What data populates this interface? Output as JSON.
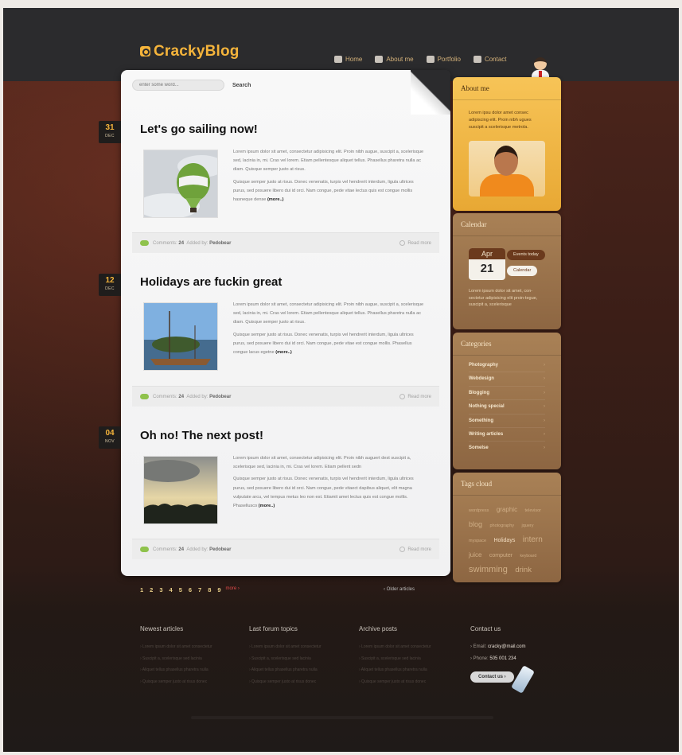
{
  "header": {
    "logo": "CrackyBlog",
    "nav": [
      "Home",
      "About me",
      "Portfolio",
      "Contact"
    ]
  },
  "search": {
    "placeholder": "enter some word...",
    "button": "Search"
  },
  "posts": [
    {
      "day": "31",
      "month": "DEC",
      "title": "Let's go sailing now!",
      "p1": "Lorem ipsum dolor sit amet, consectetur adipisicing elit. Proin nibh augue, suscipit a, scelerisque sed, lacinia in, mi. Cras vel lorem. Etiam pellentesque aliquet tellus. Phasellus pharetra nulla ac diam. Quisque semper justo at risus.",
      "p2": "Quisque semper justo at risus. Donec venenatis, turpis vel hendrerit interdum, ligula ultrices purus, sed posuere libero dui id orci. Nam congue, pede vitae lectus quis est congue mollis hasneque dense",
      "more": "(more..)",
      "comments_label": "Comments:",
      "comments": "24",
      "added_label": "Added by:",
      "author": "Pedobear",
      "read_more": "Read more"
    },
    {
      "day": "12",
      "month": "DEC",
      "title": "Holidays are fuckin great",
      "p1": "Lorem ipsum dolor sit amet, consectetur adipisicing elit. Proin nibh augue, suscipit a, scelerisque sed, lacinia in, mi. Cras vel lorem. Etiam pellentesque aliquet tellus. Phasellus pharetra nulla ac diam. Quisque semper justo at risus.",
      "p2": "Quisque semper justo at risus. Donec venenatis, turpis vel hendrerit interdum, ligula ultrices purus, sed posuere libero dui id orci. Nam congue, pede vitae est congue mollis. Phasellus congue lacus egetne",
      "more": "(more..)",
      "comments_label": "Comments:",
      "comments": "24",
      "added_label": "Added by:",
      "author": "Pedobear",
      "read_more": "Read more"
    },
    {
      "day": "04",
      "month": "NOV",
      "title": "Oh no! The next post!",
      "p1": "Lorem ipsum dolor sit amet, consectetur adipisicing elit. Proin nibh auguert dest suscipit a, scelerisque sed, lacinia in, mi. Cras vel lorem. Etiam pellent sedn",
      "p2": "Quisque semper justo at risus. Donec venenatis, turpis vel hendrerit interdum, ligula ultrices purus, sed posuere libero dui id orci. Nam congue, pede vitaect dapibus aliquet, elit magna vulputate arcu, vel tempus metus leo non est. Etiamit amet lectus quis est congue mollis. Phasellusco",
      "more": "(more..)",
      "comments_label": "Comments:",
      "comments": "24",
      "added_label": "Added by:",
      "author": "Pedobear",
      "read_more": "Read more"
    }
  ],
  "pagination": {
    "pages": [
      "1",
      "2",
      "3",
      "4",
      "5",
      "6",
      "7",
      "8",
      "9"
    ],
    "more": "more ›",
    "older": "‹ Older articles"
  },
  "sidebar": {
    "about": {
      "title": "About me",
      "text": "Lorem ipsu dolor amet consec adipiscing elit. Proin nibh ugues suscipit a scelerisque metrola."
    },
    "calendar": {
      "title": "Calendar",
      "month": "Apr",
      "day": "21",
      "events_btn": "Events today",
      "calendar_btn": "Calendar",
      "text": "Lorem ipsum dolor sit amet, con-sectetur adipisicing elit proin-tegue, suscipit a, scelerisque"
    },
    "categories": {
      "title": "Categories",
      "items": [
        "Photography",
        "Webdesign",
        "Blogging",
        "Nothing special",
        "Something",
        "Writing articles",
        "Somelse"
      ]
    },
    "tags": {
      "title": "Tags cloud",
      "items": [
        "wordpress",
        "graphic",
        "televisor",
        "blog",
        "photography",
        "jquery",
        "myspace",
        "Holidays",
        "intern",
        "juice",
        "computer",
        "keyboard",
        "swimming",
        "drink"
      ]
    }
  },
  "footer": {
    "newest": {
      "title": "Newest articles",
      "links": [
        "› Lorem ipsum dolor sit amet consectetur",
        "› Suscipit a, scelerisque sed lacinia",
        "› Aliquet tellus phasellus pharetra nulla",
        "› Quisque semper justo at risus donec"
      ]
    },
    "forum": {
      "title": "Last forum topics",
      "links": [
        "› Lorem ipsum dolor sit amet consectetur",
        "› Suscipit a, scelerisque sed lacinia",
        "› Aliquet tellus phasellus pharetra nulla",
        "› Quisque semper justo at risus donec"
      ]
    },
    "archive": {
      "title": "Archive posts",
      "links": [
        "› Lorem ipsum dolor sit amet consectetur",
        "› Suscipit a, scelerisque sed lacinia",
        "› Aliquet tellus phasellus pharetra nulla",
        "› Quisque semper justo at risus donec"
      ]
    },
    "contact": {
      "title": "Contact us",
      "email_label": "› Email:",
      "email": "cracky@mail.com",
      "phone_label": "› Phone:",
      "phone": "505 001 234",
      "button": "Contact us ›"
    }
  },
  "colors": {
    "accent": "#f5b43b",
    "paper": "#f5f5f5",
    "widget_brown": "#9a7249",
    "widget_gold": "#f0b748"
  }
}
